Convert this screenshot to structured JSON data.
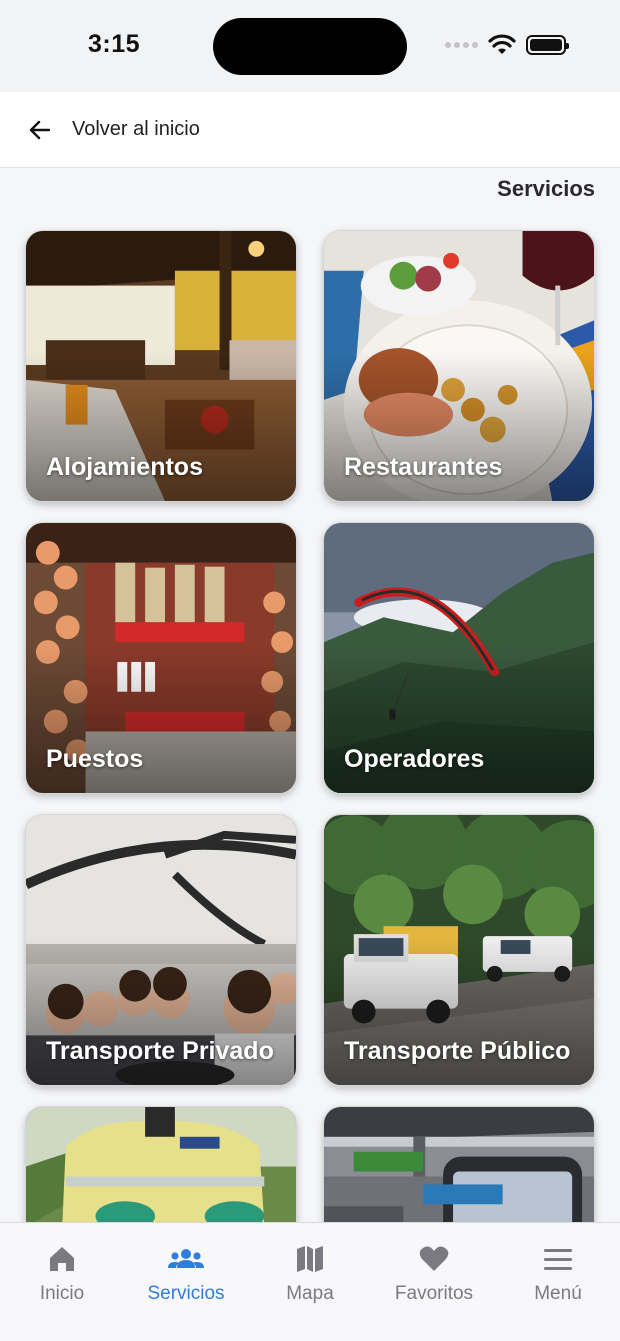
{
  "status_bar": {
    "time": "3:15"
  },
  "header": {
    "back_label": "Volver al inicio"
  },
  "page": {
    "section_title": "Servicios"
  },
  "services": [
    {
      "label": "Alojamientos"
    },
    {
      "label": "Restaurantes"
    },
    {
      "label": "Puestos"
    },
    {
      "label": "Operadores"
    },
    {
      "label": "Transporte Privado"
    },
    {
      "label": "Transporte Público"
    },
    {
      "label": ""
    },
    {
      "label": ""
    }
  ],
  "tabbar": {
    "items": [
      {
        "label": "Inicio",
        "icon": "home-icon"
      },
      {
        "label": "Servicios",
        "icon": "users-icon"
      },
      {
        "label": "Mapa",
        "icon": "map-icon"
      },
      {
        "label": "Favoritos",
        "icon": "heart-icon"
      },
      {
        "label": "Menú",
        "icon": "menu-icon"
      }
    ],
    "active": "Servicios",
    "active_color": "#2f7de1",
    "inactive_color": "#7a7a80"
  }
}
